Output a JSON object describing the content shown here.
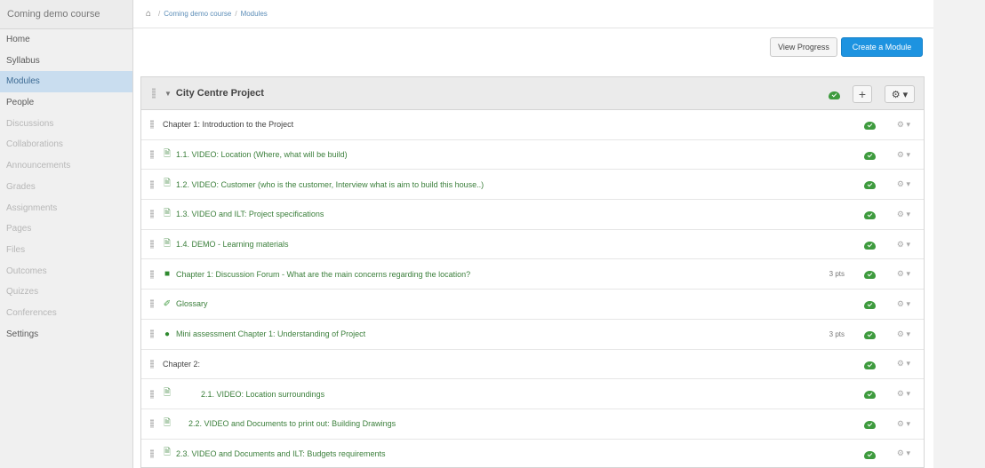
{
  "sidebar": {
    "course_title": "Coming demo course",
    "items": [
      {
        "label": "Home",
        "state": "normal"
      },
      {
        "label": "Syllabus",
        "state": "normal"
      },
      {
        "label": "Modules",
        "state": "active"
      },
      {
        "label": "People",
        "state": "normal"
      },
      {
        "label": "Discussions",
        "state": "muted"
      },
      {
        "label": "Collaborations",
        "state": "muted"
      },
      {
        "label": "Announcements",
        "state": "muted"
      },
      {
        "label": "Grades",
        "state": "muted"
      },
      {
        "label": "Assignments",
        "state": "muted"
      },
      {
        "label": "Pages",
        "state": "muted"
      },
      {
        "label": "Files",
        "state": "muted"
      },
      {
        "label": "Outcomes",
        "state": "muted"
      },
      {
        "label": "Quizzes",
        "state": "muted"
      },
      {
        "label": "Conferences",
        "state": "muted"
      },
      {
        "label": "Settings",
        "state": "normal"
      }
    ]
  },
  "breadcrumb": {
    "course": "Coming demo course",
    "separator": "/",
    "current": "Modules"
  },
  "header": {
    "view_progress_label": "View Progress",
    "create_module_label": "Create a Module"
  },
  "module": {
    "title": "City Centre Project",
    "add_label": "+",
    "gear_label": "⚙ ▾",
    "items": [
      {
        "type": "header",
        "title": "Chapter 1: Introduction to the Project",
        "meta": ""
      },
      {
        "type": "page",
        "title": "1.1. VIDEO: Location (Where, what will be build)",
        "meta": ""
      },
      {
        "type": "page",
        "title": "1.2. VIDEO: Customer (who is the customer, Interview what is aim to build this house..)",
        "meta": ""
      },
      {
        "type": "page",
        "title": "1.3. VIDEO and ILT: Project specifications",
        "meta": ""
      },
      {
        "type": "page",
        "title": "1.4. DEMO - Learning materials",
        "meta": ""
      },
      {
        "type": "discussion",
        "title": "Chapter 1: Discussion Forum - What are the main concerns regarding the location?",
        "meta": "3 pts"
      },
      {
        "type": "link",
        "title": "Glossary",
        "meta": ""
      },
      {
        "type": "quiz",
        "title": "Mini assessment Chapter 1: Understanding of Project",
        "meta": "3 pts"
      },
      {
        "type": "header",
        "title": "Chapter 2:",
        "meta": ""
      },
      {
        "type": "page",
        "title": "2.1. VIDEO: Location surroundings",
        "meta": "",
        "indent": 2
      },
      {
        "type": "page",
        "title": "2.2. VIDEO and Documents to print out: Building Drawings",
        "meta": "",
        "indent": 1
      },
      {
        "type": "page",
        "title": "2.3. VIDEO and Documents and ILT: Budgets requirements",
        "meta": ""
      }
    ]
  },
  "icons": {
    "page": "page-icon",
    "discussion": "discussion-icon",
    "link": "link-icon",
    "quiz": "quiz-icon",
    "published": "published-cloud-icon",
    "gear": "gear-icon"
  },
  "colors": {
    "accent": "#1d93e0",
    "published": "#3e9b3e",
    "item_text": "#3b7f3b",
    "active_nav_bg": "#c9ddef"
  }
}
